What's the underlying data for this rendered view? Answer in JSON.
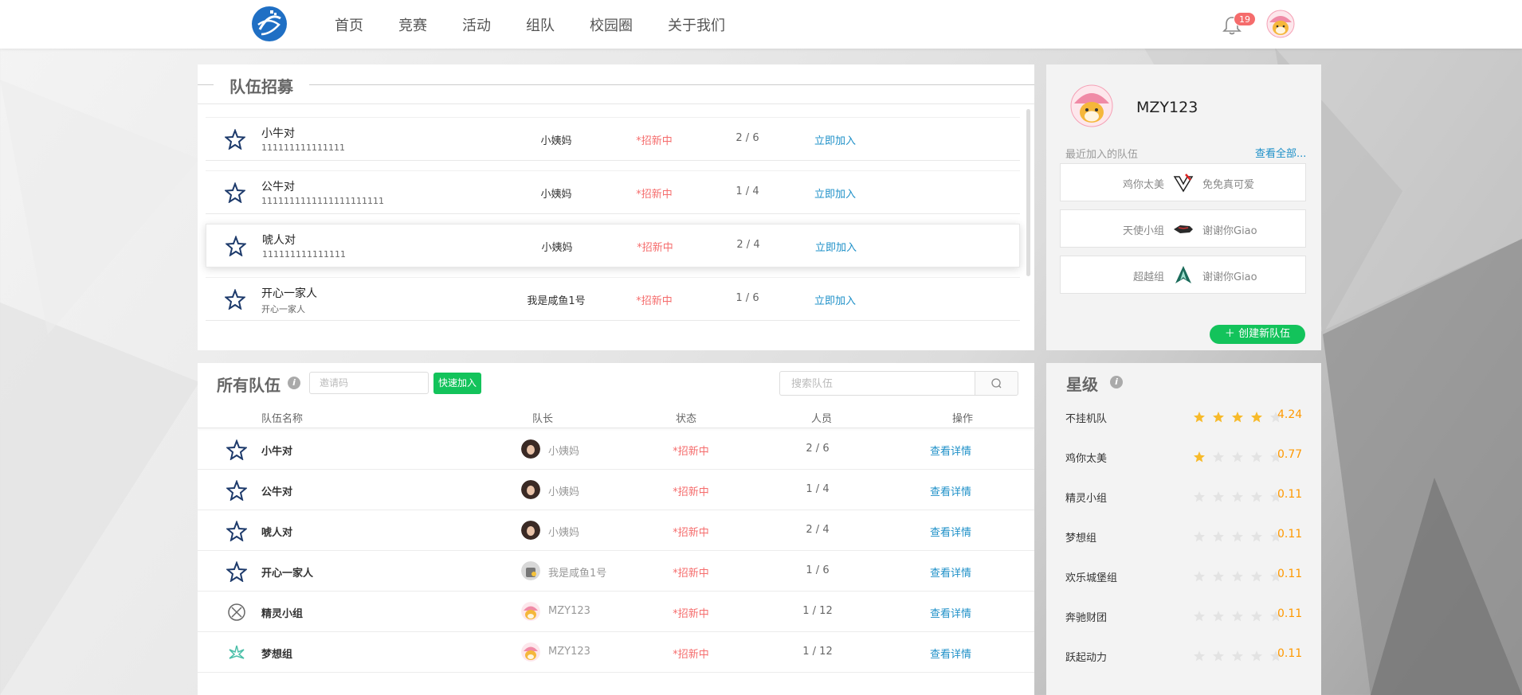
{
  "nav": {
    "links": [
      "首页",
      "竞赛",
      "活动",
      "组队",
      "校园圈",
      "关于我们"
    ],
    "notification_count": "19"
  },
  "recruit": {
    "title": "队伍招募",
    "rows": [
      {
        "name": "小牛对",
        "desc": "111111111111111",
        "leader": "小姨妈",
        "status": "*招新中",
        "count": "2 / 6",
        "action": "立即加入"
      },
      {
        "name": "公牛对",
        "desc": "1111111111111111111111",
        "leader": "小姨妈",
        "status": "*招新中",
        "count": "1 / 4",
        "action": "立即加入"
      },
      {
        "name": "唬人对",
        "desc": "111111111111111",
        "leader": "小姨妈",
        "status": "*招新中",
        "count": "2 / 4",
        "action": "立即加入"
      },
      {
        "name": "开心一家人",
        "desc": "开心一家人",
        "leader": "我是咸鱼1号",
        "status": "*招新中",
        "count": "1 / 6",
        "action": "立即加入"
      }
    ]
  },
  "profile": {
    "username": "MZY123",
    "recent_label": "最近加入的队伍",
    "view_all": "查看全部...",
    "recent_teams": [
      {
        "name": "鸡你太美",
        "leader": "免免真可爱"
      },
      {
        "name": "天使小组",
        "leader": "谢谢你Giao"
      },
      {
        "name": "超越组",
        "leader": "谢谢你Giao"
      }
    ],
    "create_button": "创建新队伍"
  },
  "all_teams": {
    "title": "所有队伍",
    "invite_placeholder": "邀请码",
    "quick_join": "快速加入",
    "search_placeholder": "搜索队伍",
    "headers": {
      "name": "队伍名称",
      "leader": "队长",
      "status": "状态",
      "members": "人员",
      "action": "操作"
    },
    "rows": [
      {
        "name": "小牛对",
        "leader": "小姨妈",
        "status": "*招新中",
        "count": "2 / 6",
        "action": "查看详情",
        "icon": "star-icon",
        "avatar": "girl"
      },
      {
        "name": "公牛对",
        "leader": "小姨妈",
        "status": "*招新中",
        "count": "1 / 4",
        "action": "查看详情",
        "icon": "star-icon",
        "avatar": "girl"
      },
      {
        "name": "唬人对",
        "leader": "小姨妈",
        "status": "*招新中",
        "count": "2 / 4",
        "action": "查看详情",
        "icon": "star-icon",
        "avatar": "girl"
      },
      {
        "name": "开心一家人",
        "leader": "我是咸鱼1号",
        "status": "*招新中",
        "count": "1 / 6",
        "action": "查看详情",
        "icon": "star-icon",
        "avatar": "fish"
      },
      {
        "name": "精灵小组",
        "leader": "MZY123",
        "status": "*招新中",
        "count": "1 / 12",
        "action": "查看详情",
        "icon": "elf-icon",
        "avatar": "shiba"
      },
      {
        "name": "梦想组",
        "leader": "MZY123",
        "status": "*招新中",
        "count": "1 / 12",
        "action": "查看详情",
        "icon": "dream-icon",
        "avatar": "shiba"
      }
    ]
  },
  "ratings": {
    "title": "星级",
    "items": [
      {
        "name": "不挂机队",
        "score": "4.24",
        "stars": 4.24
      },
      {
        "name": "鸡你太美",
        "score": "0.77",
        "stars": 0.77
      },
      {
        "name": "精灵小组",
        "score": "0.11",
        "stars": 0.11
      },
      {
        "name": "梦想组",
        "score": "0.11",
        "stars": 0.11
      },
      {
        "name": "欢乐城堡组",
        "score": "0.11",
        "stars": 0.11
      },
      {
        "name": "奔驰财团",
        "score": "0.11",
        "stars": 0.11
      },
      {
        "name": "跃起动力",
        "score": "0.11",
        "stars": 0.11
      }
    ]
  },
  "colors": {
    "accent": "#1e90c8",
    "status": "#f56c6c",
    "green": "#13c35b",
    "star": "#f7ba2a",
    "score": "#ff9900"
  }
}
